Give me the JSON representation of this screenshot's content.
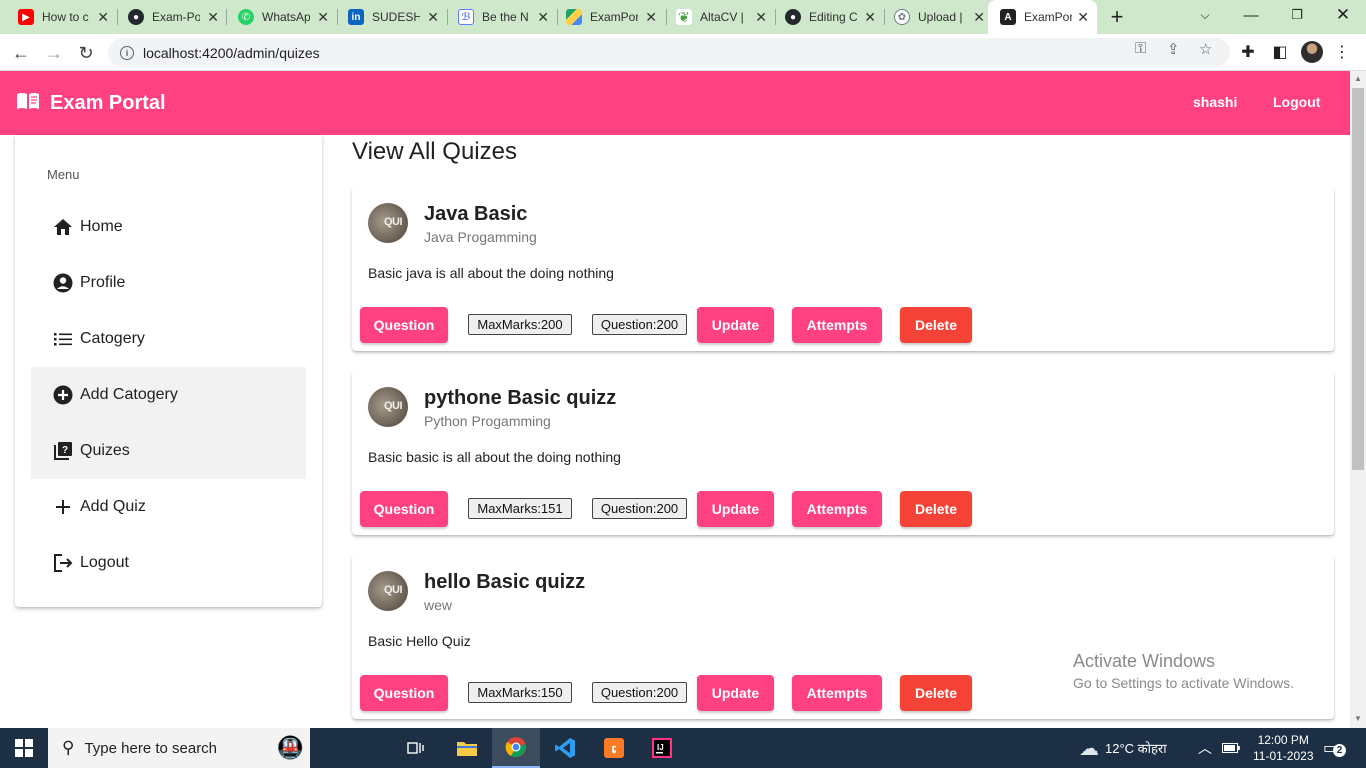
{
  "browser": {
    "tabs": [
      {
        "title": "How to c",
        "icon": "youtube-icon",
        "color": "#ff0000"
      },
      {
        "title": "Exam-Po",
        "icon": "github-icon",
        "color": "#24292e"
      },
      {
        "title": "WhatsAp",
        "icon": "whatsapp-icon",
        "color": "#25d366"
      },
      {
        "title": "SUDESH",
        "icon": "linkedin-icon",
        "color": "#0a66c2"
      },
      {
        "title": "Be the N",
        "icon": "be-icon",
        "color": "#5b7cff"
      },
      {
        "title": "ExamPor",
        "icon": "google-drive-icon",
        "color": "#1fa463"
      },
      {
        "title": "AltaCV |",
        "icon": "overleaf-icon",
        "color": "#47a141"
      },
      {
        "title": "Editing C",
        "icon": "github-icon",
        "color": "#24292e"
      },
      {
        "title": "Upload |",
        "icon": "openai-icon",
        "color": "#6b7a80"
      },
      {
        "title": "ExamPor",
        "icon": "angular-icon",
        "color": "#222222"
      }
    ],
    "url": "localhost:4200/admin/quizes"
  },
  "app": {
    "brand": "Exam Portal",
    "user": "shashi",
    "logout": "Logout",
    "accent": "#ff4081",
    "danger": "#f44336"
  },
  "sidebar": {
    "title": "Menu",
    "items": [
      {
        "label": "Home",
        "icon": "home-icon",
        "highlighted": false
      },
      {
        "label": "Profile",
        "icon": "account-circle-icon",
        "highlighted": false
      },
      {
        "label": "Catogery",
        "icon": "list-icon",
        "highlighted": false
      },
      {
        "label": "Add Catogery",
        "icon": "add-circle-icon",
        "highlighted": true
      },
      {
        "label": "Quizes",
        "icon": "quiz-icon",
        "highlighted": true
      },
      {
        "label": "Add Quiz",
        "icon": "add-icon",
        "highlighted": false
      },
      {
        "label": "Logout",
        "icon": "logout-icon",
        "highlighted": false
      }
    ]
  },
  "main": {
    "title": "View All Quizes",
    "avatar_text": "QUI",
    "quizzes": [
      {
        "title": "Java Basic",
        "category": "Java Progamming",
        "description": "Basic java is all about the doing nothing",
        "max_marks": "MaxMarks:200",
        "questions": "Question:200"
      },
      {
        "title": "pythone Basic quizz",
        "category": "Python Progamming",
        "description": "Basic basic is all about the doing nothing",
        "max_marks": "MaxMarks:151",
        "questions": "Question:200"
      },
      {
        "title": "hello Basic quizz",
        "category": "wew",
        "description": "Basic Hello Quiz",
        "max_marks": "MaxMarks:150",
        "questions": "Question:200"
      }
    ],
    "buttons": {
      "question": "Question",
      "update": "Update",
      "attempts": "Attempts",
      "delete": "Delete"
    }
  },
  "watermark": {
    "line1": "Activate Windows",
    "line2": "Go to Settings to activate Windows."
  },
  "taskbar": {
    "search_placeholder": "Type here to search",
    "weather": "12°C कोहरा",
    "time": "12:00 PM",
    "date": "11-01-2023",
    "notifications": "2"
  }
}
